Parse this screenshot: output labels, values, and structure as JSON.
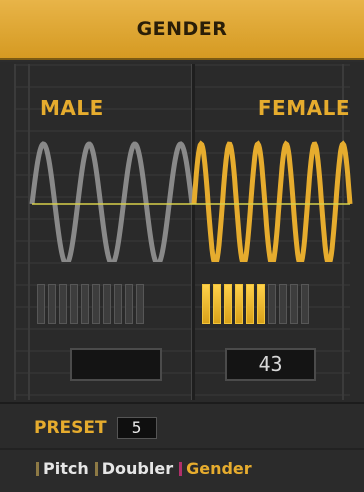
{
  "header": {
    "title": "GENDER"
  },
  "display": {
    "left_label": "MALE",
    "right_label": "FEMALE",
    "left_value": "",
    "right_value": "43",
    "meter_segments": 10,
    "right_meter_lit": 6,
    "left_meter_lit": 0
  },
  "footer": {
    "preset_label": "PRESET",
    "preset_value": "5",
    "tabs": [
      {
        "label": "Pitch",
        "active": false
      },
      {
        "label": "Doubler",
        "active": false
      },
      {
        "label": "Gender",
        "active": true
      }
    ]
  },
  "colors": {
    "accent": "#e6ac2e",
    "male_wave": "#8f8f8f",
    "female_wave": "#e6ac2e",
    "active_tick": "#b0306a"
  }
}
